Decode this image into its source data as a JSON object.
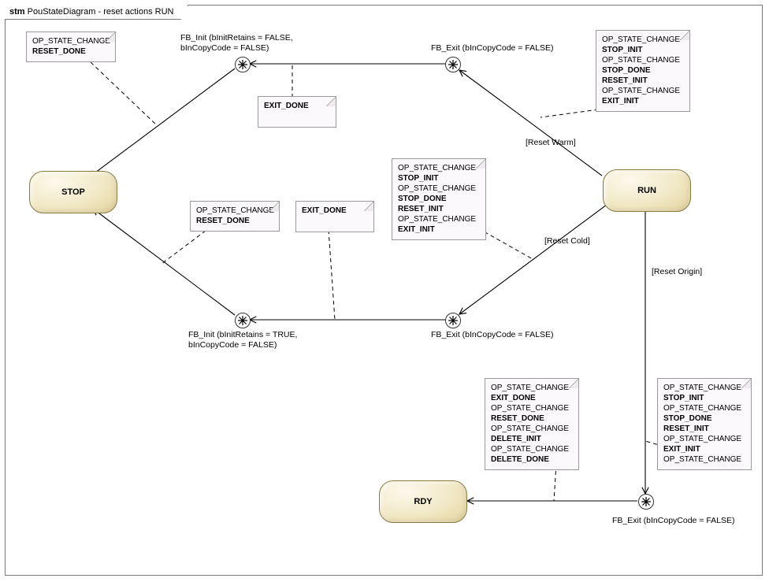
{
  "title_prefix": "stm ",
  "title_main": "PouStateDiagram - reset actions RUN",
  "states": {
    "stop": "STOP",
    "run": "RUN",
    "rdy": "RDY"
  },
  "choice_labels": {
    "c1": "FB_Init (bInitRetains = FALSE,\nbInCopyCode = FALSE)",
    "c2": "FB_Exit (bInCopyCode = FALSE)",
    "c3": "FB_Init (bInitRetains = TRUE,\nbInCopyCode = FALSE)",
    "c4": "FB_Exit (bInCopyCode = FALSE)",
    "c5": "FB_Exit (bInCopyCode = FALSE)"
  },
  "guards": {
    "reset_warm": "[Reset Warm]",
    "reset_cold": "[Reset Cold]",
    "reset_origin": "[Reset Origin]"
  },
  "notes": {
    "n1": {
      "lines": [
        "OP_STATE_CHANGE"
      ],
      "bold_lines": [
        "RESET_DONE"
      ]
    },
    "n2": {
      "bold_lines": [
        "EXIT_DONE"
      ]
    },
    "n3": {
      "sequence": [
        {
          "t": "OP_STATE_CHANGE"
        },
        {
          "t": "STOP_INIT",
          "b": true
        },
        {
          "t": "OP_STATE_CHANGE"
        },
        {
          "t": "STOP_DONE",
          "b": true
        },
        {
          "t": "RESET_INIT",
          "b": true
        },
        {
          "t": "OP_STATE_CHANGE"
        },
        {
          "t": "EXIT_INIT",
          "b": true
        }
      ]
    },
    "n4": {
      "lines": [
        "OP_STATE_CHANGE"
      ],
      "bold_lines": [
        "RESET_DONE"
      ]
    },
    "n5": {
      "bold_lines": [
        "EXIT_DONE"
      ]
    },
    "n6": {
      "sequence": [
        {
          "t": "OP_STATE_CHANGE"
        },
        {
          "t": "STOP_INIT",
          "b": true
        },
        {
          "t": "OP_STATE_CHANGE"
        },
        {
          "t": "STOP_DONE",
          "b": true
        },
        {
          "t": "RESET_INIT",
          "b": true
        },
        {
          "t": "OP_STATE_CHANGE"
        },
        {
          "t": "EXIT_INIT",
          "b": true
        }
      ]
    },
    "n7": {
      "sequence": [
        {
          "t": "OP_STATE_CHANGE"
        },
        {
          "t": "EXIT_DONE",
          "b": true
        },
        {
          "t": "OP_STATE_CHANGE"
        },
        {
          "t": "RESET_DONE",
          "b": true
        },
        {
          "t": "OP_STATE_CHANGE"
        },
        {
          "t": "DELETE_INIT",
          "b": true
        },
        {
          "t": "OP_STATE_CHANGE"
        },
        {
          "t": "DELETE_DONE",
          "b": true
        }
      ]
    },
    "n8": {
      "sequence": [
        {
          "t": "OP_STATE_CHANGE"
        },
        {
          "t": "STOP_INIT",
          "b": true
        },
        {
          "t": "OP_STATE_CHANGE"
        },
        {
          "t": "STOP_DONE",
          "b": true
        },
        {
          "t": "RESET_INIT",
          "b": true
        },
        {
          "t": "OP_STATE_CHANGE"
        },
        {
          "t": "EXIT_INIT",
          "b": true
        },
        {
          "t": "OP_STATE_CHANGE"
        }
      ]
    }
  }
}
